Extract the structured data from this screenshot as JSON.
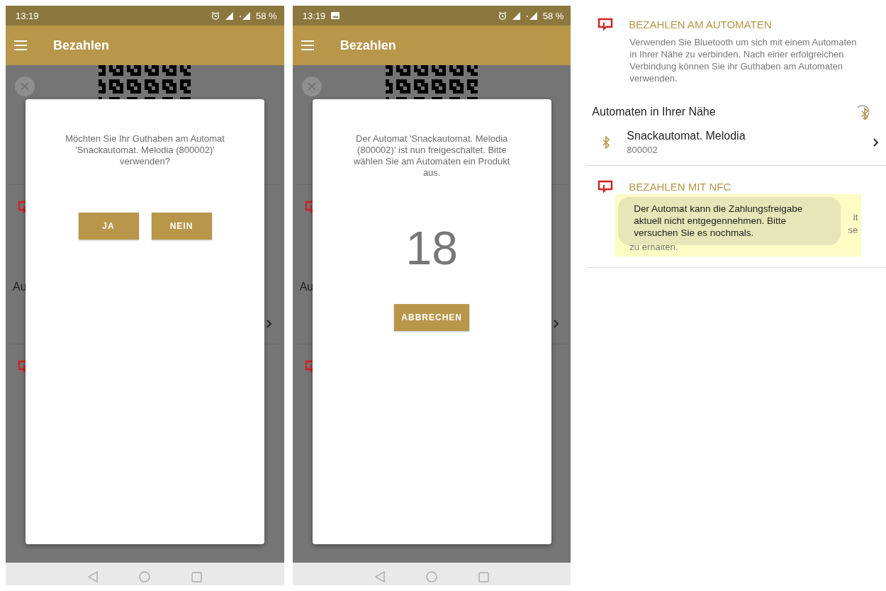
{
  "phones": [
    {
      "status_bar": {
        "time": "13:19",
        "image_notification": false,
        "battery": "58 %"
      },
      "app_bar": {
        "title": "Bezahlen"
      },
      "backdrop": {
        "partial_heading": "Au"
      },
      "dialog": {
        "kind": "confirm",
        "message": "Möchten Sie Ihr Guthaben am Automat 'Snackautomat. Melodia (800002)' verwenden?",
        "buttons": [
          "JA",
          "NEIN"
        ]
      }
    },
    {
      "status_bar": {
        "time": "13:19",
        "image_notification": true,
        "battery": "58 %"
      },
      "app_bar": {
        "title": "Bezahlen"
      },
      "backdrop": {
        "partial_heading": "Au"
      },
      "dialog": {
        "kind": "countdown",
        "message": "Der Automat 'Snackautomat. Melodia (800002)' ist nun freigeschaltet. Bitte wählen Sie am Automaten ein Produkt aus.",
        "countdown": "18",
        "buttons": [
          "ABBRECHEN"
        ]
      }
    }
  ],
  "detail": {
    "sections": [
      {
        "title": "BEZAHLEN AM AUTOMATEN",
        "description": "Verwenden Sie Bluetooth um sich mit einem Automaten in Ihrer Nähe zu verbinden. Nach einer erfolgreichen Verbindung können Sie ihr Guthaben am Automaten verwenden.",
        "nearby_heading": "Automaten in Ihrer Nähe",
        "devices": [
          {
            "name": "Snackautomat. Melodia",
            "id": "800002"
          }
        ]
      },
      {
        "title": "BEZAHLEN MIT NFC",
        "covered_text": {
          "right_fragments": [
            "it",
            "se"
          ],
          "last_line": "zu erhalten."
        }
      }
    ],
    "toast": {
      "message": "Der Automat kann die Zahlungsfreigabe aktuell nicht entgegennehmen. Bitte versuchen Sie es nochmals.",
      "highlighted": true
    }
  }
}
